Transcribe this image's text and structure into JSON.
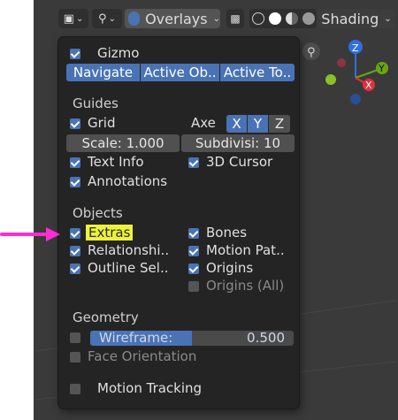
{
  "header": {
    "overlays_label": "Overlays",
    "shading_label": "Shading"
  },
  "gizmo": {
    "title": "Gizmo",
    "buttons": [
      "Navigate",
      "Active Ob..",
      "Active To.."
    ]
  },
  "guides": {
    "title": "Guides",
    "grid": "Grid",
    "axes": "Axe",
    "axis_x": "X",
    "axis_y": "Y",
    "axis_z": "Z",
    "scale": "Scale: 1.000",
    "subdivisions": "Subdivisi: 10",
    "text_info": "Text Info",
    "cursor_3d": "3D Cursor",
    "annotations": "Annotations"
  },
  "objects": {
    "title": "Objects",
    "extras": "Extras",
    "bones": "Bones",
    "relationships": "Relationshi..",
    "motion_paths": "Motion Pat..",
    "outline_selected": "Outline Sel..",
    "origins": "Origins",
    "origins_all": "Origins (All)"
  },
  "geometry": {
    "title": "Geometry",
    "wireframe_label": "Wireframe:",
    "wireframe_value": "0.500",
    "wireframe_fraction": 0.5,
    "face_orientation": "Face Orientation"
  },
  "motion_tracking": "Motion Tracking",
  "nav_gizmo": {
    "z": "Z",
    "y": "Y",
    "x": "X"
  },
  "colors": {
    "accent": "#4a73b5",
    "highlight": "#eef23a",
    "arrow": "#ff2bd6"
  }
}
